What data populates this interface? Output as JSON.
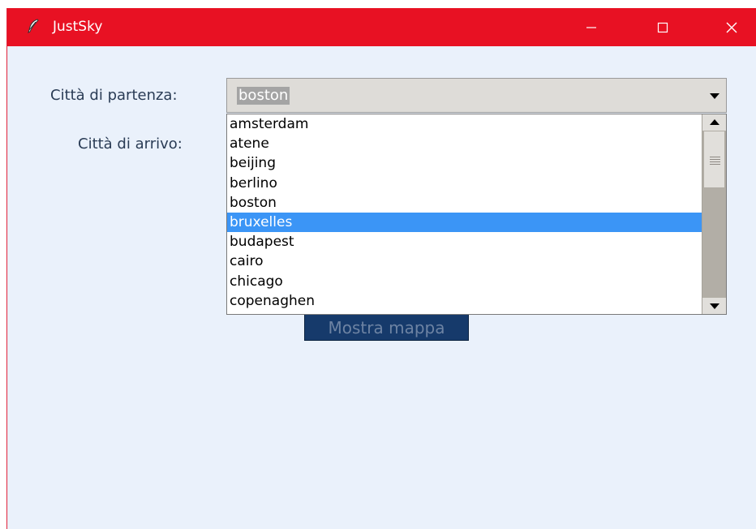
{
  "window": {
    "title": "JustSky",
    "controls": {
      "minimize": "minimize-icon",
      "maximize": "maximize-icon",
      "close": "close-icon"
    },
    "title_bar_color": "#e81123",
    "background_color": "#eaf1fb"
  },
  "form": {
    "departure_label": "Città di partenza:",
    "arrival_label": "Città di arrivo:",
    "departure_value": "boston",
    "show_map_button": "Mostra mappa"
  },
  "dropdown": {
    "items": [
      "amsterdam",
      "atene",
      "beijing",
      "berlino",
      "boston",
      "bruxelles",
      "budapest",
      "cairo",
      "chicago",
      "copenaghen"
    ],
    "highlighted": "bruxelles",
    "highlight_color": "#3b95f6"
  }
}
